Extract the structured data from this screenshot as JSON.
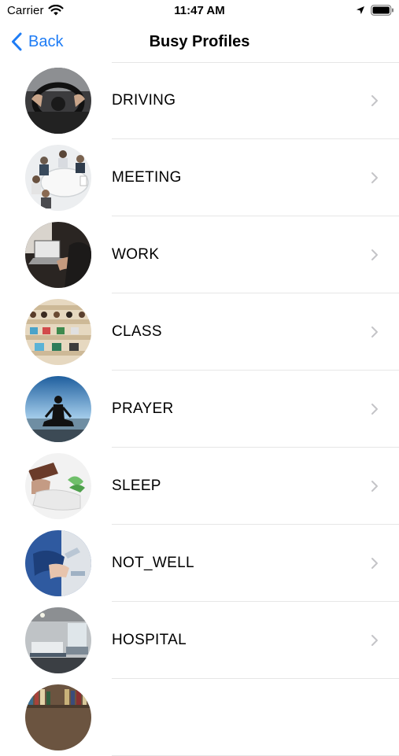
{
  "status_bar": {
    "carrier": "Carrier",
    "time": "11:47 AM"
  },
  "nav": {
    "back_label": "Back",
    "title": "Busy Profiles"
  },
  "profiles": [
    {
      "label": "DRIVING",
      "icon": "driving-photo-icon"
    },
    {
      "label": "MEETING",
      "icon": "meeting-photo-icon"
    },
    {
      "label": "WORK",
      "icon": "work-photo-icon"
    },
    {
      "label": "CLASS",
      "icon": "class-photo-icon"
    },
    {
      "label": "PRAYER",
      "icon": "prayer-photo-icon"
    },
    {
      "label": "SLEEP",
      "icon": "sleep-photo-icon"
    },
    {
      "label": "NOT_WELL",
      "icon": "not-well-photo-icon"
    },
    {
      "label": "HOSPITAL",
      "icon": "hospital-photo-icon"
    },
    {
      "label": "",
      "icon": "library-photo-icon"
    }
  ],
  "colors": {
    "accent": "#1e7cf5",
    "separator": "#e6e6e6",
    "chevron": "#c4c4c7"
  }
}
